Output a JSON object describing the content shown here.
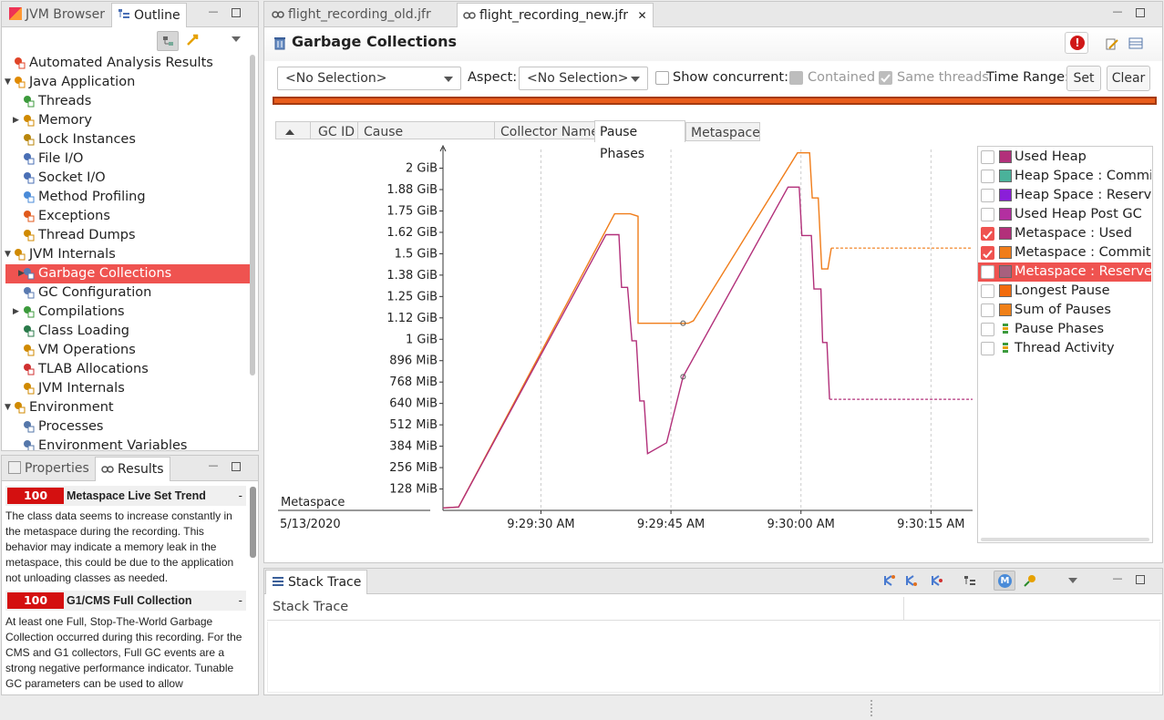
{
  "left_top_tabs": {
    "browser": "JVM Browser",
    "outline": "Outline"
  },
  "outline_tree": [
    {
      "label": "Automated Analysis Results",
      "icon": "analysis-icon",
      "level": 0,
      "arrow": ""
    },
    {
      "label": "Java Application",
      "icon": "java-app-icon",
      "level": 0,
      "arrow": "expanded"
    },
    {
      "label": "Threads",
      "icon": "threads-icon",
      "level": 1,
      "arrow": ""
    },
    {
      "label": "Memory",
      "icon": "memory-icon",
      "level": 1,
      "arrow": "collapsed"
    },
    {
      "label": "Lock Instances",
      "icon": "lock-icon",
      "level": 1,
      "arrow": ""
    },
    {
      "label": "File I/O",
      "icon": "file-io-icon",
      "level": 1,
      "arrow": ""
    },
    {
      "label": "Socket I/O",
      "icon": "socket-io-icon",
      "level": 1,
      "arrow": ""
    },
    {
      "label": "Method Profiling",
      "icon": "method-profiling-icon",
      "level": 1,
      "arrow": ""
    },
    {
      "label": "Exceptions",
      "icon": "exceptions-icon",
      "level": 1,
      "arrow": ""
    },
    {
      "label": "Thread Dumps",
      "icon": "thread-dumps-icon",
      "level": 1,
      "arrow": ""
    },
    {
      "label": "JVM Internals",
      "icon": "jvm-internals-icon",
      "level": 0,
      "arrow": "expanded"
    },
    {
      "label": "Garbage Collections",
      "icon": "garbage-collections-icon",
      "level": 1,
      "arrow": "collapsed",
      "selected": true
    },
    {
      "label": "GC Configuration",
      "icon": "gc-config-icon",
      "level": 1,
      "arrow": ""
    },
    {
      "label": "Compilations",
      "icon": "compilations-icon",
      "level": 1,
      "arrow": "collapsed"
    },
    {
      "label": "Class Loading",
      "icon": "class-loading-icon",
      "level": 1,
      "arrow": ""
    },
    {
      "label": "VM Operations",
      "icon": "vm-operations-icon",
      "level": 1,
      "arrow": ""
    },
    {
      "label": "TLAB Allocations",
      "icon": "tlab-icon",
      "level": 1,
      "arrow": ""
    },
    {
      "label": "JVM Internals",
      "icon": "jvm-internals-icon",
      "level": 1,
      "arrow": ""
    },
    {
      "label": "Environment",
      "icon": "environment-icon",
      "level": 0,
      "arrow": "expanded"
    },
    {
      "label": "Processes",
      "icon": "processes-icon",
      "level": 1,
      "arrow": ""
    },
    {
      "label": "Environment Variables",
      "icon": "env-vars-icon",
      "level": 1,
      "arrow": ""
    }
  ],
  "left_bottom_tabs": {
    "properties": "Properties",
    "results": "Results"
  },
  "results": [
    {
      "score": "100",
      "title": "Metaspace Live Set Trend",
      "text": "The class data seems to increase constantly in the metaspace during the recording. This behavior may indicate a memory leak in the metaspace, this could be due to the application not unloading classes as needed."
    },
    {
      "score": "100",
      "title": "G1/CMS Full Collection",
      "text": "At least one Full, Stop-The-World Garbage Collection occurred during this recording. For the CMS and G1 collectors, Full GC events are a strong negative performance indicator. Tunable GC parameters can be used to allow"
    }
  ],
  "editor_tabs": [
    {
      "label": "flight_recording_old.jfr",
      "active": false
    },
    {
      "label": "flight_recording_new.jfr",
      "active": true
    }
  ],
  "page": {
    "title": "Garbage Collections",
    "filter_combo": "<No Selection>",
    "aspect_label": "Aspect:",
    "aspect_combo": "<No Selection>",
    "show_concurrent": "Show concurrent:",
    "contained": "Contained",
    "same_threads": "Same threads",
    "time_range": "Time Range:",
    "set": "Set",
    "clear": "Clear"
  },
  "table_columns": [
    "GC ID",
    "Cause",
    "Collector Name"
  ],
  "chart_tabs": [
    "Pause Phases",
    "Metaspace"
  ],
  "chart_data": {
    "type": "line",
    "xlabel": "5/13/2020",
    "ylabel": "Metaspace",
    "y_unit": "MiB",
    "y_ticks": [
      "128 MiB",
      "256 MiB",
      "384 MiB",
      "512 MiB",
      "640 MiB",
      "768 MiB",
      "896 MiB",
      "1 GiB",
      "1.12 GiB",
      "1.25 GiB",
      "1.38 GiB",
      "1.5 GiB",
      "1.62 GiB",
      "1.75 GiB",
      "1.88 GiB",
      "2 GiB"
    ],
    "y_tick_values": [
      128,
      256,
      384,
      512,
      640,
      768,
      896,
      1024,
      1152,
      1280,
      1408,
      1536,
      1664,
      1792,
      1920,
      2048
    ],
    "ylim": [
      0,
      2160
    ],
    "x_ticks": [
      "9:29:30 AM",
      "9:29:45 AM",
      "9:30:00 AM",
      "9:30:15 AM"
    ],
    "x_tick_values": [
      30,
      45,
      60,
      75
    ],
    "x_unit": "seconds after 9:29:00 AM",
    "xlim": [
      18.7,
      79.8
    ],
    "grid": true,
    "series": [
      {
        "name": "Metaspace : Committed",
        "color": "#f07d1a",
        "points": [
          [
            18.7,
            15
          ],
          [
            20.5,
            20
          ],
          [
            38.5,
            1775
          ],
          [
            40.3,
            1775
          ],
          [
            41.2,
            1760
          ],
          [
            41.2,
            1120
          ],
          [
            47.0,
            1120
          ],
          [
            47.6,
            1135
          ],
          [
            59.6,
            2140
          ],
          [
            61.0,
            2140
          ],
          [
            61.3,
            1870
          ],
          [
            62.0,
            1870
          ],
          [
            62.4,
            1445
          ],
          [
            63.1,
            1445
          ],
          [
            63.5,
            1570
          ],
          [
            79.8,
            1570
          ]
        ],
        "dashed_from": 63.5
      },
      {
        "name": "Metaspace : Used",
        "color": "#b2307a",
        "points": [
          [
            18.7,
            15
          ],
          [
            20.5,
            20
          ],
          [
            37.5,
            1650
          ],
          [
            39.0,
            1650
          ],
          [
            39.3,
            1335
          ],
          [
            40.0,
            1335
          ],
          [
            40.5,
            1015
          ],
          [
            41.0,
            1015
          ],
          [
            41.4,
            655
          ],
          [
            41.9,
            655
          ],
          [
            42.3,
            340
          ],
          [
            44.5,
            405
          ],
          [
            46.4,
            800
          ],
          [
            58.5,
            1935
          ],
          [
            59.8,
            1935
          ],
          [
            60.1,
            1645
          ],
          [
            61.2,
            1645
          ],
          [
            61.5,
            1325
          ],
          [
            62.3,
            1325
          ],
          [
            62.5,
            1005
          ],
          [
            63.0,
            1005
          ],
          [
            63.3,
            665
          ],
          [
            79.8,
            665
          ]
        ],
        "dashed_from": 63.3
      }
    ],
    "markers": [
      {
        "series": "Metaspace : Committed",
        "x": 46.4,
        "y": 1120
      },
      {
        "series": "Metaspace : Used",
        "x": 46.4,
        "y": 800
      }
    ]
  },
  "legend": [
    {
      "label": "Used Heap",
      "color": "#b2307a",
      "checked": false,
      "selected": false,
      "icon": ""
    },
    {
      "label": "Heap Space : Committed",
      "color": "#4ab29a",
      "checked": false,
      "selected": false,
      "icon": ""
    },
    {
      "label": "Heap Space : Reserved",
      "color": "#8a1fd8",
      "checked": false,
      "selected": false,
      "icon": ""
    },
    {
      "label": "Used Heap Post GC",
      "color": "#b32fa0",
      "checked": false,
      "selected": false,
      "icon": ""
    },
    {
      "label": "Metaspace : Used",
      "color": "#b2307a",
      "checked": true,
      "selected": false,
      "icon": ""
    },
    {
      "label": "Metaspace : Committed",
      "color": "#f07d1a",
      "checked": true,
      "selected": false,
      "icon": ""
    },
    {
      "label": "Metaspace : Reserved",
      "color": "#a8607e",
      "checked": false,
      "selected": true,
      "icon": ""
    },
    {
      "label": "Longest Pause",
      "color": "#f26b0c",
      "checked": false,
      "selected": false,
      "icon": ""
    },
    {
      "label": "Sum of Pauses",
      "color": "#f08018",
      "checked": false,
      "selected": false,
      "icon": ""
    },
    {
      "label": "Pause Phases",
      "color": "",
      "checked": false,
      "selected": false,
      "icon": "pause-phases-icon"
    },
    {
      "label": "Thread Activity",
      "color": "",
      "checked": false,
      "selected": false,
      "icon": "thread-activity-icon"
    }
  ],
  "stack_trace": {
    "tab": "Stack Trace",
    "column": "Stack Trace"
  }
}
